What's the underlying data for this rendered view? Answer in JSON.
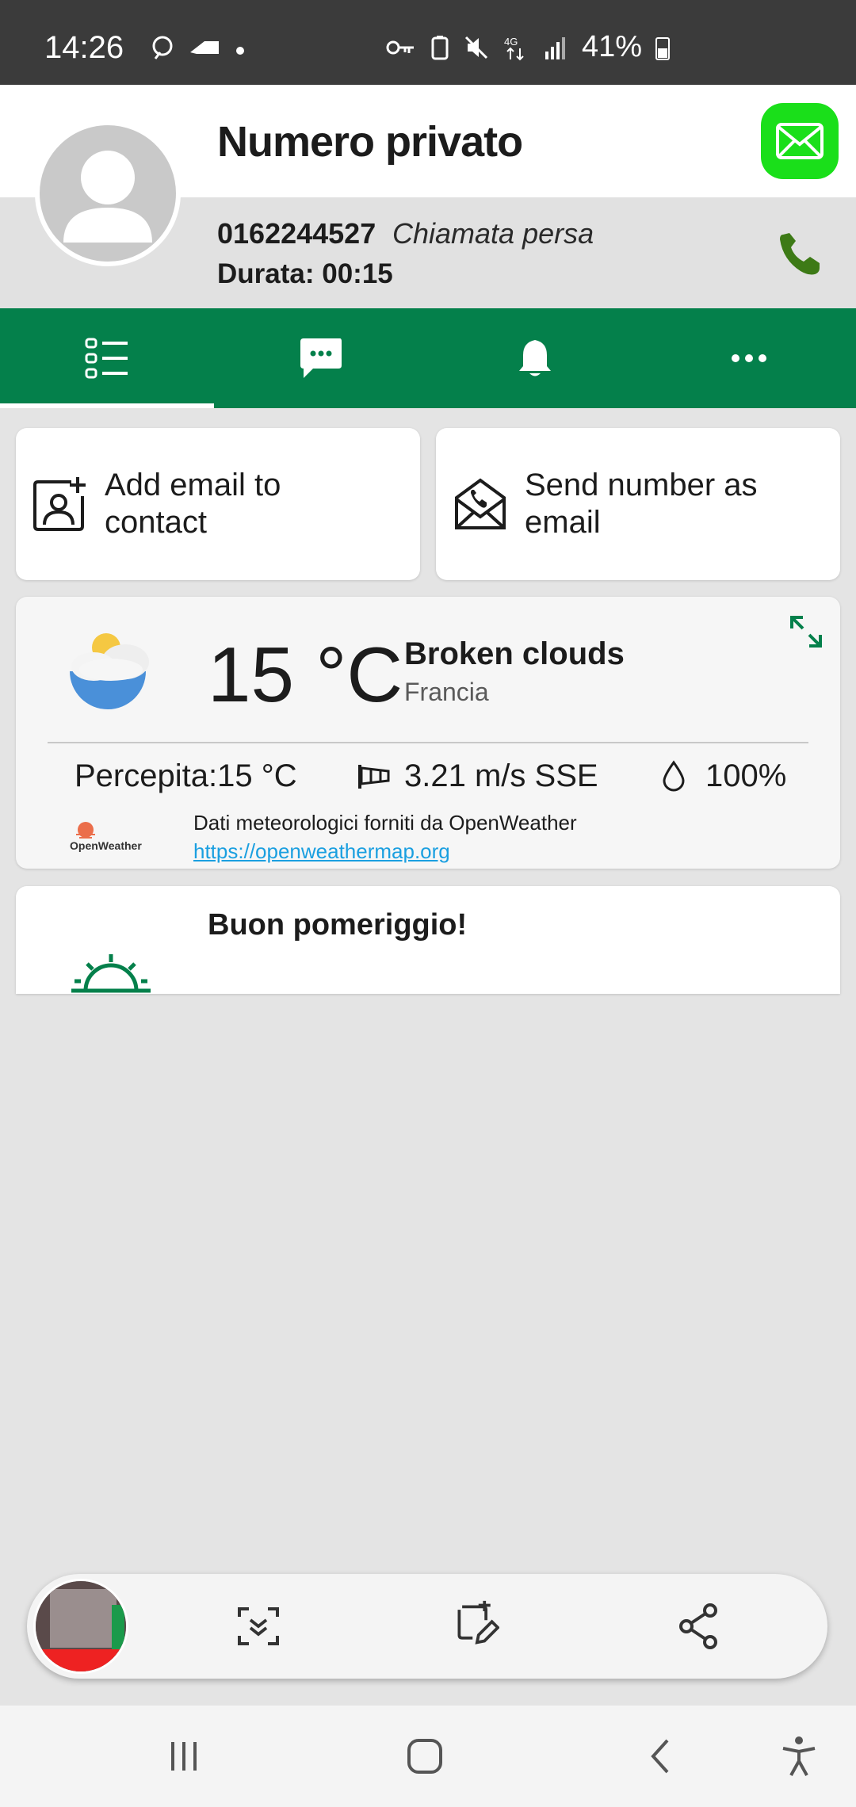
{
  "status_bar": {
    "time": "14:26",
    "battery": "41%"
  },
  "caller": {
    "name": "Numero privato",
    "number": "0162244527",
    "status": "Chiamata persa",
    "duration": "Durata: 00:15"
  },
  "tabs": [
    {
      "icon": "list-icon",
      "selected": true
    },
    {
      "icon": "message-icon",
      "selected": false
    },
    {
      "icon": "bell-icon",
      "selected": false
    },
    {
      "icon": "more-icon",
      "selected": false
    }
  ],
  "actions": {
    "add_email": "Add email to contact",
    "send_number": "Send number as email"
  },
  "weather": {
    "temperature": "15 °C",
    "description": "Broken clouds",
    "place": "Francia",
    "feels_like": "Percepita:15 °C",
    "wind": "3.21 m/s SSE",
    "humidity": "100%",
    "credit": "Dati meteorologici forniti da OpenWeather",
    "link": "https://openweathermap.org",
    "logo_text": "OpenWeather"
  },
  "greeting": {
    "text": "Buon pomeriggio!"
  },
  "colors": {
    "primary_green": "#04804b",
    "mail_green": "#1adf1a",
    "phone_green": "#3d7a16",
    "link_blue": "#1a9fe0"
  }
}
